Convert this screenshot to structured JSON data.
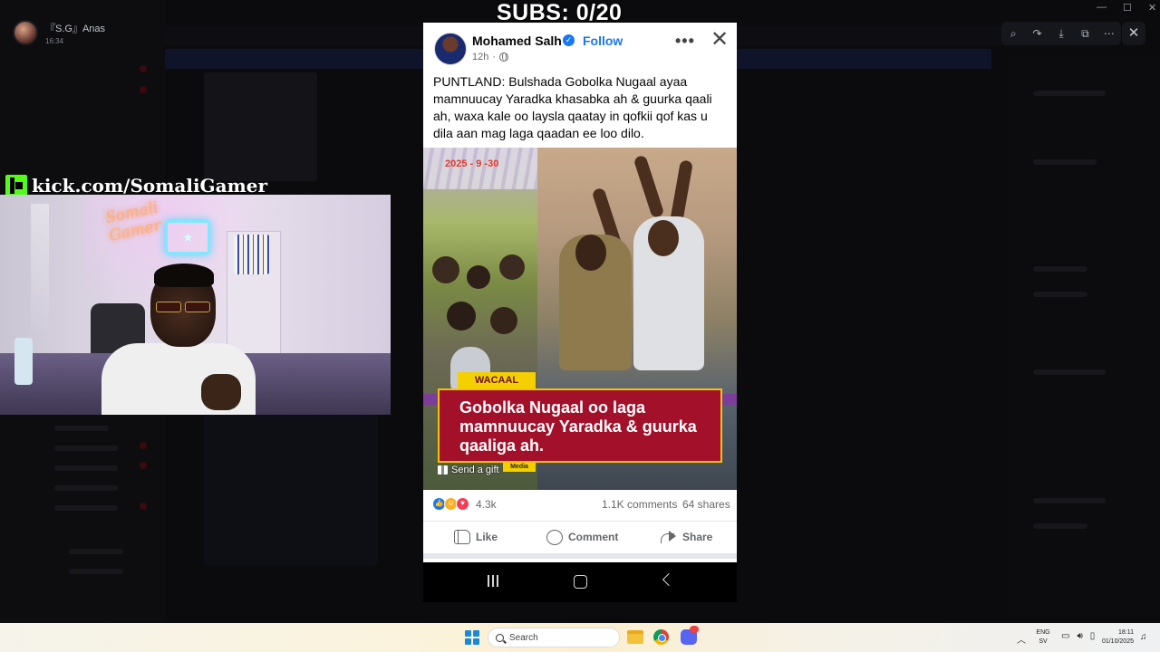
{
  "overlay": {
    "subs_counter": "SUBS: 0/20",
    "kick_url": "kick.com/SomaliGamer"
  },
  "background_app": {
    "user_name": "『S.G』Anas",
    "user_time": "16:34"
  },
  "post": {
    "author": "Mohamed Salh",
    "follow_label": "Follow",
    "time": "12h",
    "text": "PUNTLAND: Bulshada Gobolka Nugaal ayaa mamnuucay Yaradka khasabka ah & guurka qaali ah, waxa kale oo laysla qaatay in qofkii qof kas u dila aan mag laga qaadan ee loo dilo.",
    "image": {
      "date_stamp": "2025 - 9 -30",
      "tag": "WACAAL",
      "headline": "Gobolka Nugaal oo laga mamnuucay Yaradka & guurka qaaliga ah.",
      "media_tag": "Media",
      "gift_label": "Send a gift"
    },
    "reaction_count": "4.3k",
    "comment_count": "1.1K comments",
    "share_count": "64 shares",
    "actions": {
      "like": "Like",
      "comment": "Comment",
      "share": "Share"
    }
  },
  "taskbar": {
    "search_placeholder": "Search",
    "lang_line1": "ENG",
    "lang_line2": "SV",
    "time": "18:11",
    "date": "01/10/2025"
  },
  "colors": {
    "facebook_blue": "#1877f2",
    "kick_green": "#53fc18",
    "headline_red": "#a3102a",
    "tag_yellow": "#f5d000"
  },
  "icons": [
    "verified-icon",
    "globe-icon",
    "more-icon",
    "close-icon",
    "like-icon",
    "comment-icon",
    "share-icon",
    "gift-icon",
    "search-icon",
    "zoom-icon",
    "rotate-icon",
    "download-icon",
    "open-external-icon"
  ]
}
